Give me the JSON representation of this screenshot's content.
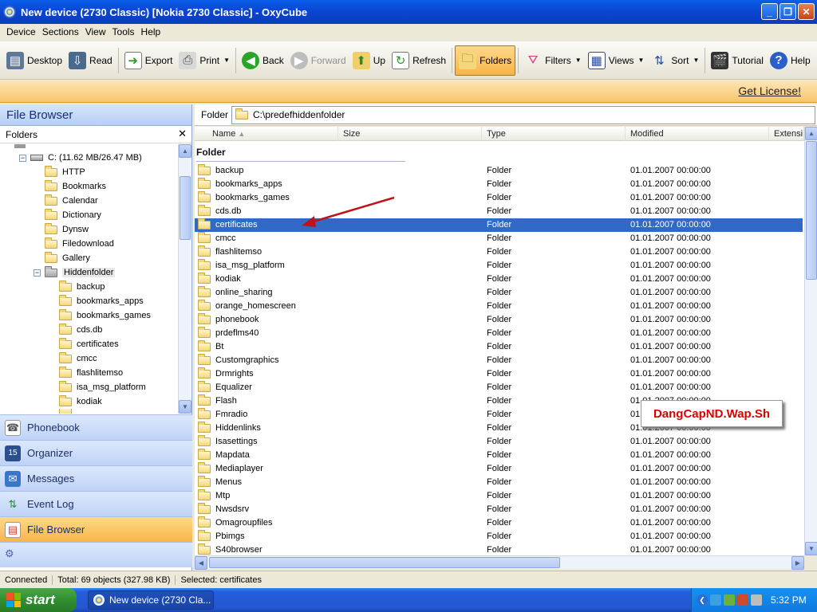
{
  "window": {
    "title": "New device (2730 Classic) [Nokia 2730 Classic] - OxyCube"
  },
  "menu": [
    "Device",
    "Sections",
    "View",
    "Tools",
    "Help"
  ],
  "toolbar": {
    "desktop": "Desktop",
    "read": "Read",
    "export": "Export",
    "print": "Print",
    "back": "Back",
    "forward": "Forward",
    "up": "Up",
    "refresh": "Refresh",
    "folders": "Folders",
    "filters": "Filters",
    "views": "Views",
    "sort": "Sort",
    "tutorial": "Tutorial",
    "help": "Help"
  },
  "license": "Get License!",
  "left_panel": {
    "title": "File Browser",
    "folders_label": "Folders"
  },
  "tree": {
    "drive": "C: (11.62 MB/26.47 MB)",
    "items": [
      "HTTP",
      "Bookmarks",
      "Calendar",
      "Dictionary",
      "Dynsw",
      "Filedownload",
      "Gallery",
      "Hiddenfolder"
    ],
    "sub_items": [
      "backup",
      "bookmarks_apps",
      "bookmarks_games",
      "cds.db",
      "certificates",
      "cmcc",
      "flashlitemso",
      "isa_msg_platform",
      "kodiak"
    ]
  },
  "nav": [
    "Phonebook",
    "Organizer",
    "Messages",
    "Event Log",
    "File Browser"
  ],
  "path": {
    "label": "Folder",
    "value": "C:\\predefhiddenfolder"
  },
  "columns": [
    "Name",
    "Size",
    "Type",
    "Modified",
    "Extensi"
  ],
  "group": "Folder",
  "files": [
    {
      "name": "backup",
      "type": "Folder",
      "modified": "01.01.2007 00:00:00"
    },
    {
      "name": "bookmarks_apps",
      "type": "Folder",
      "modified": "01.01.2007 00:00:00"
    },
    {
      "name": "bookmarks_games",
      "type": "Folder",
      "modified": "01.01.2007 00:00:00"
    },
    {
      "name": "cds.db",
      "type": "Folder",
      "modified": "01.01.2007 00:00:00"
    },
    {
      "name": "certificates",
      "type": "Folder",
      "modified": "01.01.2007 00:00:00"
    },
    {
      "name": "cmcc",
      "type": "Folder",
      "modified": "01.01.2007 00:00:00"
    },
    {
      "name": "flashlitemso",
      "type": "Folder",
      "modified": "01.01.2007 00:00:00"
    },
    {
      "name": "isa_msg_platform",
      "type": "Folder",
      "modified": "01.01.2007 00:00:00"
    },
    {
      "name": "kodiak",
      "type": "Folder",
      "modified": "01.01.2007 00:00:00"
    },
    {
      "name": "online_sharing",
      "type": "Folder",
      "modified": "01.01.2007 00:00:00"
    },
    {
      "name": "orange_homescreen",
      "type": "Folder",
      "modified": "01.01.2007 00:00:00"
    },
    {
      "name": "phonebook",
      "type": "Folder",
      "modified": "01.01.2007 00:00:00"
    },
    {
      "name": "prdeflms40",
      "type": "Folder",
      "modified": "01.01.2007 00:00:00"
    },
    {
      "name": "Bt",
      "type": "Folder",
      "modified": "01.01.2007 00:00:00"
    },
    {
      "name": "Customgraphics",
      "type": "Folder",
      "modified": "01.01.2007 00:00:00"
    },
    {
      "name": "Drmrights",
      "type": "Folder",
      "modified": "01.01.2007 00:00:00"
    },
    {
      "name": "Equalizer",
      "type": "Folder",
      "modified": "01.01.2007 00:00:00"
    },
    {
      "name": "Flash",
      "type": "Folder",
      "modified": "01.01.2007 00:00:00"
    },
    {
      "name": "Fmradio",
      "type": "Folder",
      "modified": "01.01.2007 00:00:00"
    },
    {
      "name": "Hiddenlinks",
      "type": "Folder",
      "modified": "01.01.2007 00:00:00"
    },
    {
      "name": "Isasettings",
      "type": "Folder",
      "modified": "01.01.2007 00:00:00"
    },
    {
      "name": "Mapdata",
      "type": "Folder",
      "modified": "01.01.2007 00:00:00"
    },
    {
      "name": "Mediaplayer",
      "type": "Folder",
      "modified": "01.01.2007 00:00:00"
    },
    {
      "name": "Menus",
      "type": "Folder",
      "modified": "01.01.2007 00:00:00"
    },
    {
      "name": "Mtp",
      "type": "Folder",
      "modified": "01.01.2007 00:00:00"
    },
    {
      "name": "Nwsdsrv",
      "type": "Folder",
      "modified": "01.01.2007 00:00:00"
    },
    {
      "name": "Omagroupfiles",
      "type": "Folder",
      "modified": "01.01.2007 00:00:00"
    },
    {
      "name": "Pbimgs",
      "type": "Folder",
      "modified": "01.01.2007 00:00:00"
    },
    {
      "name": "S40browser",
      "type": "Folder",
      "modified": "01.01.2007 00:00:00"
    }
  ],
  "selected_file": "certificates",
  "watermark": "DangCapND.Wap.Sh",
  "status": {
    "connection": "Connected",
    "total": "Total: 69 objects (327.98 KB)",
    "selected": "Selected:  certificates"
  },
  "taskbar": {
    "start": "start",
    "task": "New device (2730 Cla...",
    "clock": "5:32 PM"
  },
  "colors": {
    "selection": "#316ac5",
    "title_blue": "#0a44d0",
    "active_orange": "#f7b547",
    "watermark_red": "#e00000"
  }
}
